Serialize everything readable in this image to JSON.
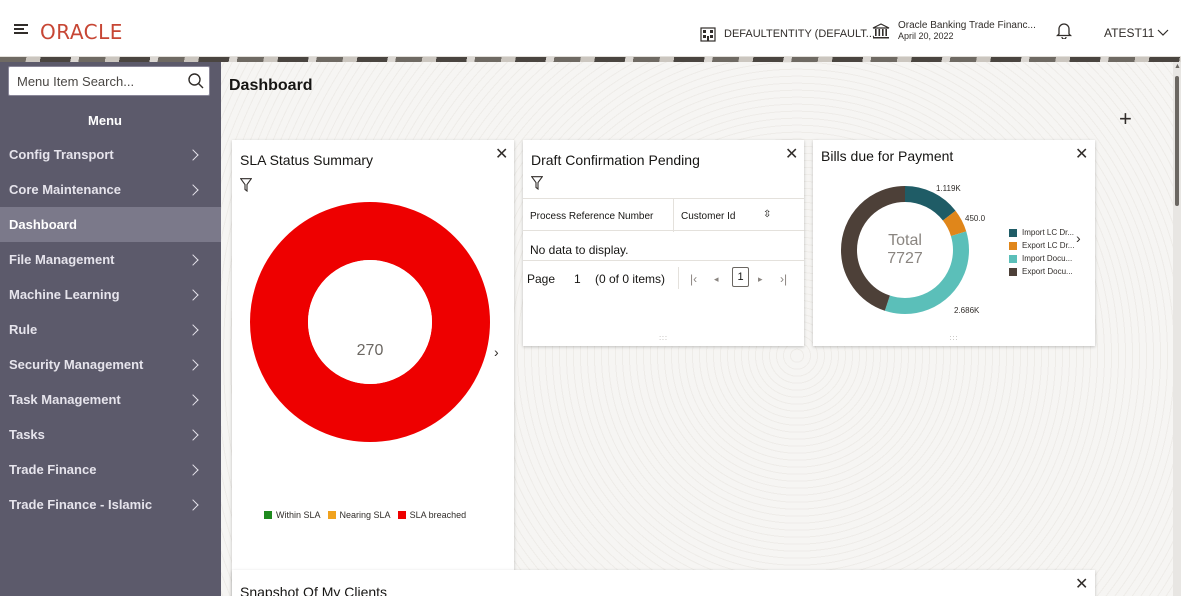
{
  "header": {
    "brand": "ORACLE",
    "entity": "DEFAULTENTITY (DEFAULT...",
    "bank_name": "Oracle Banking Trade Financ...",
    "bank_date": "April 20, 2022",
    "user": "ATEST11"
  },
  "sidebar": {
    "search_placeholder": "Menu Item Search...",
    "menu_title": "Menu",
    "items": [
      {
        "label": "Config Transport",
        "has_children": true
      },
      {
        "label": "Core Maintenance",
        "has_children": true
      },
      {
        "label": "Dashboard",
        "has_children": false,
        "active": true
      },
      {
        "label": "File Management",
        "has_children": true
      },
      {
        "label": "Machine Learning",
        "has_children": true
      },
      {
        "label": "Rule",
        "has_children": true
      },
      {
        "label": "Security Management",
        "has_children": true
      },
      {
        "label": "Task Management",
        "has_children": true
      },
      {
        "label": "Tasks",
        "has_children": true
      },
      {
        "label": "Trade Finance",
        "has_children": true
      },
      {
        "label": "Trade Finance - Islamic",
        "has_children": true
      }
    ]
  },
  "main": {
    "page_title": "Dashboard",
    "add_widget": "+"
  },
  "sla": {
    "title": "SLA Status Summary",
    "center_value": "270",
    "legend": [
      {
        "label": "Within SLA",
        "color": "#1e8a1e"
      },
      {
        "label": "Nearing SLA",
        "color": "#f0a21e"
      },
      {
        "label": "SLA breached",
        "color": "#ee0000"
      }
    ]
  },
  "draft": {
    "title": "Draft Confirmation Pending",
    "columns": [
      "Process Reference Number",
      "Customer Id"
    ],
    "empty_text": "No data to display.",
    "pager": {
      "page_label": "Page",
      "page_number": "1",
      "items_text": "(0 of 0 items)",
      "current": "1"
    }
  },
  "bills": {
    "title": "Bills due for Payment",
    "total_label": "Total",
    "total_value": "7727",
    "labels": [
      "1.119K",
      "450.0",
      "2.686K"
    ],
    "legend": [
      {
        "label": "Import LC Dr...",
        "color": "#1f5c66"
      },
      {
        "label": "Export LC Dr...",
        "color": "#e0861a"
      },
      {
        "label": "Import Docu...",
        "color": "#5bbfb9"
      },
      {
        "label": "Export Docu...",
        "color": "#4d4038"
      }
    ]
  },
  "snapshot": {
    "title": "Snapshot Of My Clients"
  },
  "colors": {
    "accent_red": "#c74634",
    "sidebar_bg": "#5c5a6b",
    "sidebar_active": "#7b798a"
  }
}
